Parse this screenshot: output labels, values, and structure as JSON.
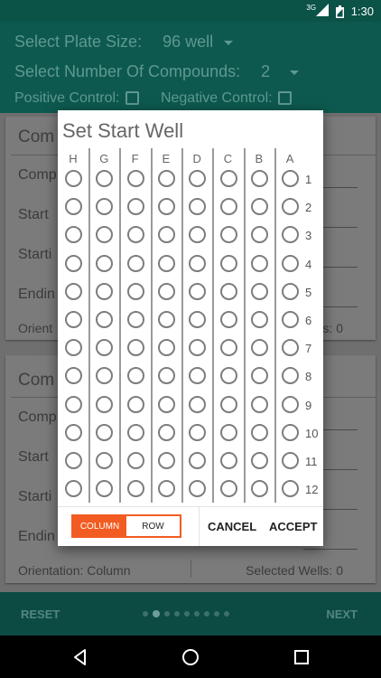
{
  "status": {
    "network": "3G",
    "time": "1:30"
  },
  "header": {
    "plate_label": "Select Plate Size:",
    "plate_value": "96 well",
    "compounds_label": "Select Number Of Compounds:",
    "compounds_value": "2",
    "positive_label": "Positive Control:",
    "negative_label": "Negative Control:"
  },
  "cards": [
    {
      "title": "Com",
      "labels": [
        "Comp",
        "Start",
        "Starti",
        "Endin"
      ],
      "orientation_label": "Orient",
      "selected_label": "s: 0"
    },
    {
      "title": "Com",
      "labels": [
        "Comp",
        "Start",
        "Starti",
        "Endin"
      ],
      "orientation_label": "Orientation: Column",
      "selected_label": "Selected Wells: 0"
    }
  ],
  "dialog": {
    "title": "Set Start Well",
    "columns": [
      "H",
      "G",
      "F",
      "E",
      "D",
      "C",
      "B",
      "A"
    ],
    "rows": [
      "1",
      "2",
      "3",
      "4",
      "5",
      "6",
      "7",
      "8",
      "9",
      "10",
      "11",
      "12"
    ],
    "toggle": {
      "column_label": "COLUMN",
      "row_label": "ROW",
      "selected": "COLUMN"
    },
    "cancel_label": "CANCEL",
    "accept_label": "ACCEPT"
  },
  "bottom": {
    "reset_label": "RESET",
    "next_label": "NEXT",
    "page_count": 9,
    "current_page": 2
  },
  "icons": {
    "back": "back-triangle-icon",
    "home": "home-circle-icon",
    "recents": "recents-square-icon"
  },
  "colors": {
    "accent": "#f25c22",
    "primary": "#0d594f"
  }
}
